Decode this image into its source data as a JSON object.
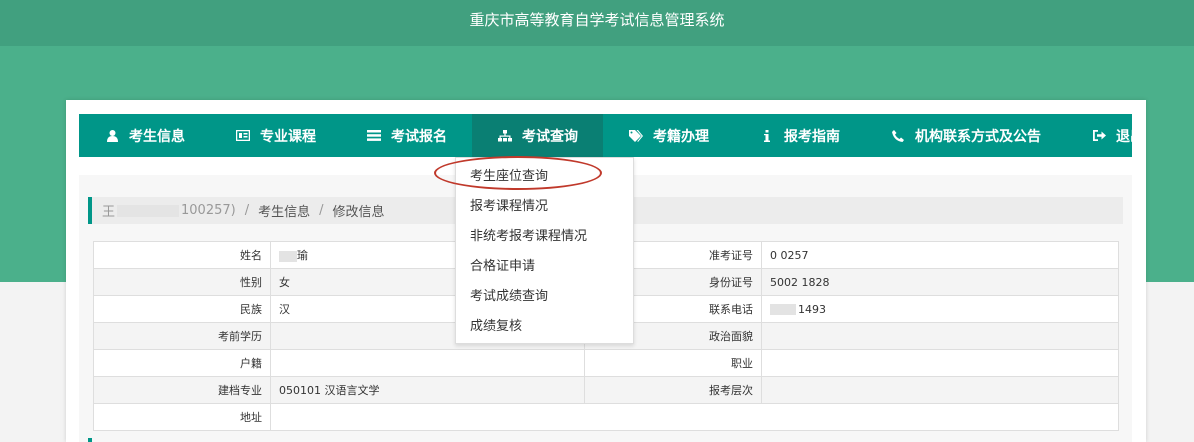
{
  "header": {
    "title": "重庆市高等教育自学考试信息管理系统"
  },
  "nav": {
    "items": [
      {
        "label": "考生信息",
        "icon": "user-icon"
      },
      {
        "label": "专业课程",
        "icon": "id-card-icon"
      },
      {
        "label": "考试报名",
        "icon": "list-icon"
      },
      {
        "label": "考试查询",
        "icon": "sitemap-icon"
      },
      {
        "label": "考籍办理",
        "icon": "tags-icon"
      },
      {
        "label": "报考指南",
        "icon": "info-icon"
      },
      {
        "label": "机构联系方式及公告",
        "icon": "phone-icon"
      },
      {
        "label": "退出",
        "icon": "sign-out-icon"
      }
    ]
  },
  "breadcrumb": {
    "name_prefix": "王",
    "id_suffix": "100257)",
    "section": "考生信息",
    "page": "修改信息",
    "separator": "/"
  },
  "dropdown": {
    "items": [
      "考生座位查询",
      "报考课程情况",
      "非统考报考课程情况",
      "合格证申请",
      "考试成绩查询",
      "成绩复核"
    ]
  },
  "info": {
    "rows": [
      {
        "l1": "姓名",
        "v1": "瑜",
        "l2": "准考证号",
        "v2": "0 0257"
      },
      {
        "l1": "性别",
        "v1": "女",
        "l2": "身份证号",
        "v2": "5002 1828"
      },
      {
        "l1": "民族",
        "v1": "汉",
        "l2": "联系电话",
        "v2": "1493"
      },
      {
        "l1": "考前学历",
        "v1": "",
        "l2": "政治面貌",
        "v2": ""
      },
      {
        "l1": "户籍",
        "v1": "",
        "l2": "职业",
        "v2": ""
      },
      {
        "l1": "建档专业",
        "v1": "050101 汉语言文学",
        "l2": "报考层次",
        "v2": ""
      },
      {
        "l1": "地址",
        "v1": ""
      }
    ]
  },
  "colors": {
    "accent": "#009688",
    "header": "#41a07f",
    "band": "#4bb08b",
    "highlight": "#c0392b"
  }
}
